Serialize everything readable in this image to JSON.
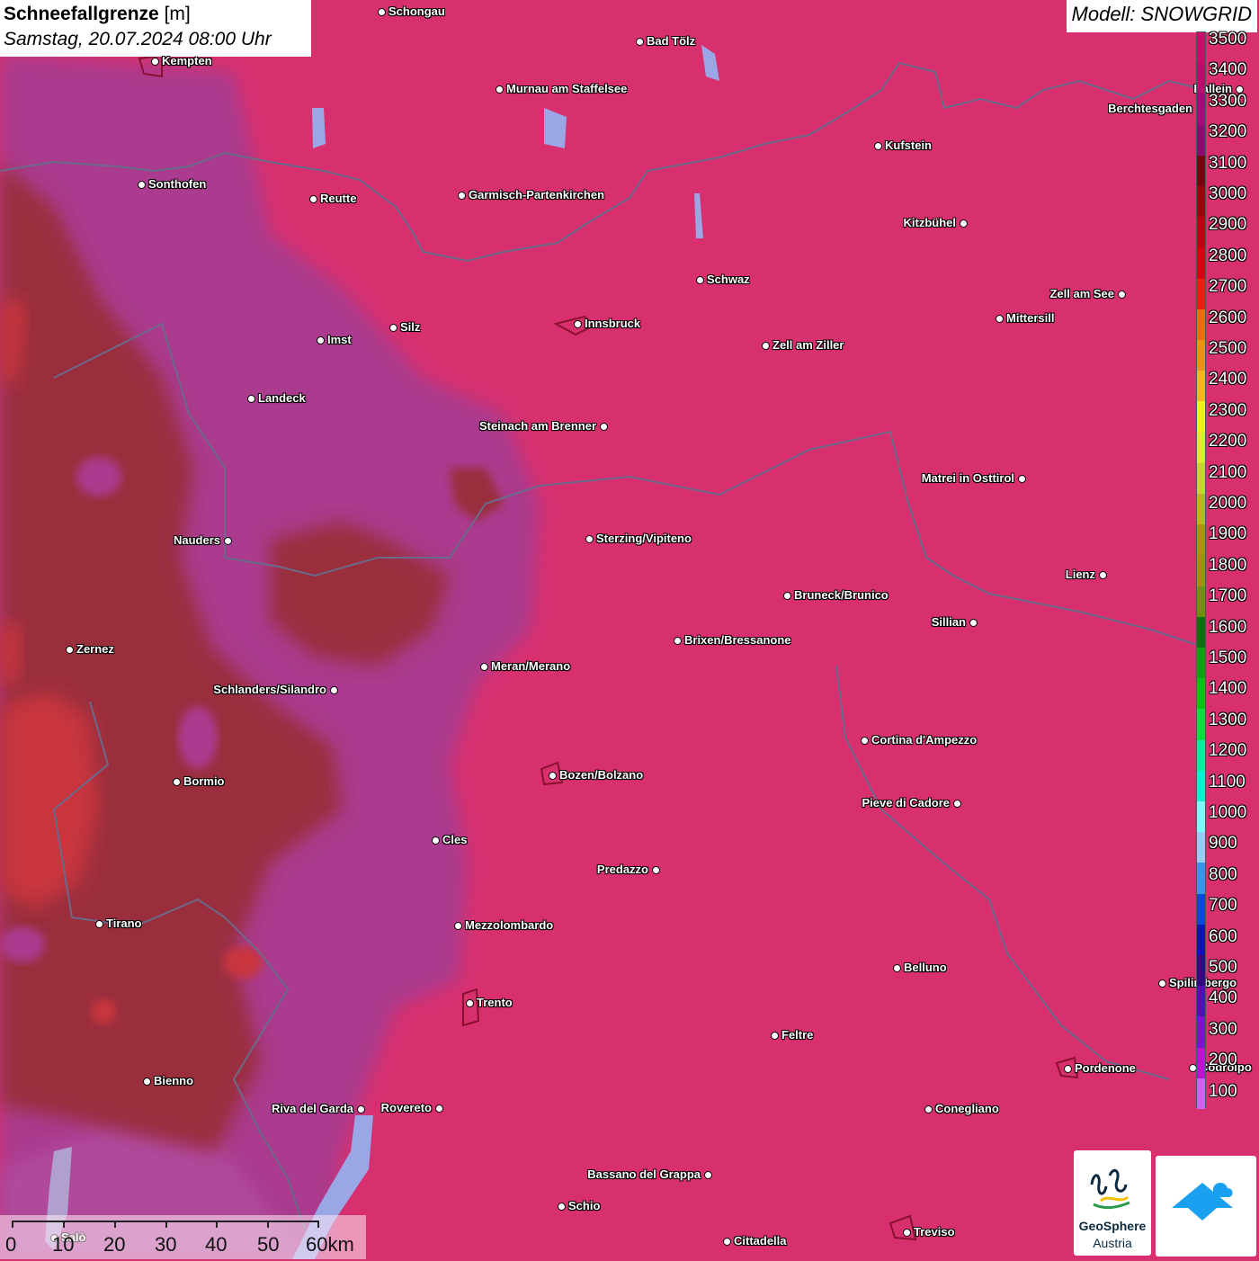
{
  "header": {
    "title_bold": "Schneefallgrenze",
    "title_unit": "[m]",
    "subtitle": "Samstag, 20.07.2024 08:00 Uhr",
    "model": "Modell: SNOWGRID"
  },
  "legend": {
    "labels": [
      "3500",
      "3400",
      "3300",
      "3200",
      "3100",
      "3000",
      "2900",
      "2800",
      "2700",
      "2600",
      "2500",
      "2400",
      "2300",
      "2200",
      "2100",
      "2000",
      "1900",
      "1800",
      "1700",
      "1600",
      "1500",
      "1400",
      "1300",
      "1200",
      "1100",
      "1000",
      "900",
      "800",
      "700",
      "600",
      "500",
      "400",
      "300",
      "200",
      "100"
    ],
    "colors": [
      "#cc0a6a",
      "#c0086a",
      "#a8087a",
      "#900870",
      "#7a0010",
      "#a00010",
      "#c00010",
      "#dc0010",
      "#f01c10",
      "#f06a10",
      "#f09010",
      "#f8b810",
      "#f8f010",
      "#d8f020",
      "#c0dc20",
      "#b8b818",
      "#b49010",
      "#a09010",
      "#709010",
      "#107010",
      "#10a010",
      "#10c010",
      "#10dc40",
      "#10e8a0",
      "#10f0d0",
      "#80f8f8",
      "#a0c8f8",
      "#4090f0",
      "#1040e8",
      "#1010c0",
      "#300880",
      "#5010b0",
      "#8010d8",
      "#c010d0",
      "#d060f0"
    ]
  },
  "colors": {
    "base_magenta": "#d8306f",
    "purple_zone": "#a93a90",
    "brown_zone": "#9a2e3a",
    "red_zone": "#c8343a"
  },
  "cities": [
    {
      "name": "Schongau"
    },
    {
      "name": "Bad Tölz"
    },
    {
      "name": "Kempten"
    },
    {
      "name": "Murnau am Staffelsee"
    },
    {
      "name": "Hallein"
    },
    {
      "name": "Berchtesgaden"
    },
    {
      "name": "Kufstein"
    },
    {
      "name": "Sonthofen"
    },
    {
      "name": "Reutte"
    },
    {
      "name": "Garmisch-Partenkirchen"
    },
    {
      "name": "Kitzbühel"
    },
    {
      "name": "Schwaz"
    },
    {
      "name": "Zell am See"
    },
    {
      "name": "Mittersill"
    },
    {
      "name": "Innsbruck"
    },
    {
      "name": "Silz"
    },
    {
      "name": "Imst"
    },
    {
      "name": "Zell am Ziller"
    },
    {
      "name": "Landeck"
    },
    {
      "name": "Steinach am Brenner"
    },
    {
      "name": "Matrei in Osttirol"
    },
    {
      "name": "Nauders"
    },
    {
      "name": "Sterzing/Vipiteno"
    },
    {
      "name": "Lienz"
    },
    {
      "name": "Bruneck/Brunico"
    },
    {
      "name": "Sillian"
    },
    {
      "name": "Brixen/Bressanone"
    },
    {
      "name": "Zernez"
    },
    {
      "name": "Meran/Merano"
    },
    {
      "name": "Schlanders/Silandro"
    },
    {
      "name": "Cortina d'Ampezzo"
    },
    {
      "name": "Bozen/Bolzano"
    },
    {
      "name": "Pieve di Cadore"
    },
    {
      "name": "Bormio"
    },
    {
      "name": "Cles"
    },
    {
      "name": "Predazzo"
    },
    {
      "name": "Tirano"
    },
    {
      "name": "Mezzolombardo"
    },
    {
      "name": "Belluno"
    },
    {
      "name": "Spilimbergo"
    },
    {
      "name": "Trento"
    },
    {
      "name": "Feltre"
    },
    {
      "name": "Pordenone"
    },
    {
      "name": "Codroipo"
    },
    {
      "name": "Bienno"
    },
    {
      "name": "Riva del Garda"
    },
    {
      "name": "Rovereto"
    },
    {
      "name": "Conegliano"
    },
    {
      "name": "Bassano del Grappa"
    },
    {
      "name": "Schio"
    },
    {
      "name": "Salò"
    },
    {
      "name": "Treviso"
    },
    {
      "name": "Cittadella"
    }
  ],
  "scale_bar": {
    "labels": [
      "0",
      "10",
      "20",
      "30",
      "40",
      "50",
      "60km"
    ]
  },
  "logos": {
    "geosphere_line1": "GeoSphere",
    "geosphere_line2": "Austria"
  }
}
